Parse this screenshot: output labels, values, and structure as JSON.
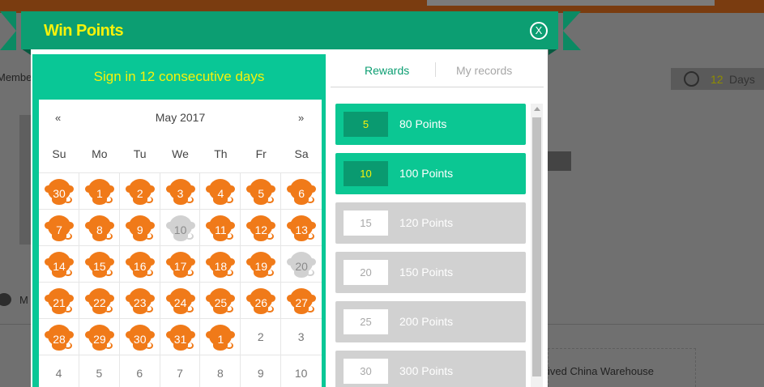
{
  "background": {
    "member_text": "Membe",
    "days_widget": {
      "count": "12",
      "label": "Days",
      "icon": "smiley-icon"
    },
    "chat_text": "M",
    "warehouse_text": "ived China Warehouse"
  },
  "header": {
    "title": "Win Points",
    "close_label": "X"
  },
  "calendar": {
    "heading": "Sign in 12 consecutive days",
    "prev": "«",
    "next": "»",
    "month": "May 2017",
    "weekdays": [
      "Su",
      "Mo",
      "Tu",
      "We",
      "Th",
      "Fr",
      "Sa"
    ],
    "weeks": [
      [
        {
          "d": "30",
          "s": "on"
        },
        {
          "d": "1",
          "s": "on"
        },
        {
          "d": "2",
          "s": "on"
        },
        {
          "d": "3",
          "s": "on"
        },
        {
          "d": "4",
          "s": "on"
        },
        {
          "d": "5",
          "s": "on"
        },
        {
          "d": "6",
          "s": "on"
        }
      ],
      [
        {
          "d": "7",
          "s": "on"
        },
        {
          "d": "8",
          "s": "on"
        },
        {
          "d": "9",
          "s": "on"
        },
        {
          "d": "10",
          "s": "off"
        },
        {
          "d": "11",
          "s": "on"
        },
        {
          "d": "12",
          "s": "on"
        },
        {
          "d": "13",
          "s": "on"
        }
      ],
      [
        {
          "d": "14",
          "s": "on"
        },
        {
          "d": "15",
          "s": "on"
        },
        {
          "d": "16",
          "s": "on"
        },
        {
          "d": "17",
          "s": "on"
        },
        {
          "d": "18",
          "s": "on"
        },
        {
          "d": "19",
          "s": "on"
        },
        {
          "d": "20",
          "s": "off"
        }
      ],
      [
        {
          "d": "21",
          "s": "on"
        },
        {
          "d": "22",
          "s": "on"
        },
        {
          "d": "23",
          "s": "on"
        },
        {
          "d": "24",
          "s": "on"
        },
        {
          "d": "25",
          "s": "on"
        },
        {
          "d": "26",
          "s": "on"
        },
        {
          "d": "27",
          "s": "on"
        }
      ],
      [
        {
          "d": "28",
          "s": "on"
        },
        {
          "d": "29",
          "s": "on"
        },
        {
          "d": "30",
          "s": "on"
        },
        {
          "d": "31",
          "s": "on"
        },
        {
          "d": "1",
          "s": "on"
        },
        {
          "d": "2",
          "s": "plain"
        },
        {
          "d": "3",
          "s": "plain"
        }
      ],
      [
        {
          "d": "4",
          "s": "plain"
        },
        {
          "d": "5",
          "s": "plain"
        },
        {
          "d": "6",
          "s": "plain"
        },
        {
          "d": "7",
          "s": "plain"
        },
        {
          "d": "8",
          "s": "plain"
        },
        {
          "d": "9",
          "s": "plain"
        },
        {
          "d": "10",
          "s": "plain"
        }
      ]
    ]
  },
  "tabs": {
    "rewards": "Rewards",
    "records": "My records"
  },
  "rewards": [
    {
      "days": "5",
      "points": "80 Points",
      "active": true
    },
    {
      "days": "10",
      "points": "100 Points",
      "active": true
    },
    {
      "days": "15",
      "points": "120 Points",
      "active": false
    },
    {
      "days": "20",
      "points": "150 Points",
      "active": false
    },
    {
      "days": "25",
      "points": "200 Points",
      "active": false
    },
    {
      "days": "30",
      "points": "300 Points",
      "active": false
    }
  ],
  "colors": {
    "primary_green": "#0bc793",
    "dark_green": "#0a9a70",
    "title_yellow": "#f7f20a",
    "monkey_orange": "#f07a19",
    "inactive_gray": "#d1d1d1"
  }
}
